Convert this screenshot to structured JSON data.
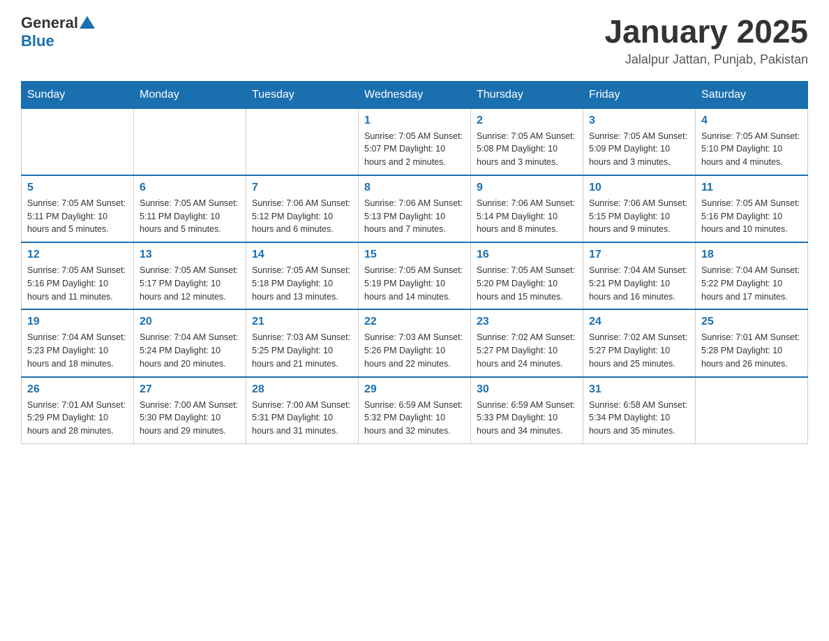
{
  "header": {
    "title": "January 2025",
    "location": "Jalalpur Jattan, Punjab, Pakistan",
    "logo_general": "General",
    "logo_blue": "Blue"
  },
  "weekdays": [
    "Sunday",
    "Monday",
    "Tuesday",
    "Wednesday",
    "Thursday",
    "Friday",
    "Saturday"
  ],
  "weeks": [
    [
      {
        "day": "",
        "info": ""
      },
      {
        "day": "",
        "info": ""
      },
      {
        "day": "",
        "info": ""
      },
      {
        "day": "1",
        "info": "Sunrise: 7:05 AM\nSunset: 5:07 PM\nDaylight: 10 hours\nand 2 minutes."
      },
      {
        "day": "2",
        "info": "Sunrise: 7:05 AM\nSunset: 5:08 PM\nDaylight: 10 hours\nand 3 minutes."
      },
      {
        "day": "3",
        "info": "Sunrise: 7:05 AM\nSunset: 5:09 PM\nDaylight: 10 hours\nand 3 minutes."
      },
      {
        "day": "4",
        "info": "Sunrise: 7:05 AM\nSunset: 5:10 PM\nDaylight: 10 hours\nand 4 minutes."
      }
    ],
    [
      {
        "day": "5",
        "info": "Sunrise: 7:05 AM\nSunset: 5:11 PM\nDaylight: 10 hours\nand 5 minutes."
      },
      {
        "day": "6",
        "info": "Sunrise: 7:05 AM\nSunset: 5:11 PM\nDaylight: 10 hours\nand 5 minutes."
      },
      {
        "day": "7",
        "info": "Sunrise: 7:06 AM\nSunset: 5:12 PM\nDaylight: 10 hours\nand 6 minutes."
      },
      {
        "day": "8",
        "info": "Sunrise: 7:06 AM\nSunset: 5:13 PM\nDaylight: 10 hours\nand 7 minutes."
      },
      {
        "day": "9",
        "info": "Sunrise: 7:06 AM\nSunset: 5:14 PM\nDaylight: 10 hours\nand 8 minutes."
      },
      {
        "day": "10",
        "info": "Sunrise: 7:06 AM\nSunset: 5:15 PM\nDaylight: 10 hours\nand 9 minutes."
      },
      {
        "day": "11",
        "info": "Sunrise: 7:05 AM\nSunset: 5:16 PM\nDaylight: 10 hours\nand 10 minutes."
      }
    ],
    [
      {
        "day": "12",
        "info": "Sunrise: 7:05 AM\nSunset: 5:16 PM\nDaylight: 10 hours\nand 11 minutes."
      },
      {
        "day": "13",
        "info": "Sunrise: 7:05 AM\nSunset: 5:17 PM\nDaylight: 10 hours\nand 12 minutes."
      },
      {
        "day": "14",
        "info": "Sunrise: 7:05 AM\nSunset: 5:18 PM\nDaylight: 10 hours\nand 13 minutes."
      },
      {
        "day": "15",
        "info": "Sunrise: 7:05 AM\nSunset: 5:19 PM\nDaylight: 10 hours\nand 14 minutes."
      },
      {
        "day": "16",
        "info": "Sunrise: 7:05 AM\nSunset: 5:20 PM\nDaylight: 10 hours\nand 15 minutes."
      },
      {
        "day": "17",
        "info": "Sunrise: 7:04 AM\nSunset: 5:21 PM\nDaylight: 10 hours\nand 16 minutes."
      },
      {
        "day": "18",
        "info": "Sunrise: 7:04 AM\nSunset: 5:22 PM\nDaylight: 10 hours\nand 17 minutes."
      }
    ],
    [
      {
        "day": "19",
        "info": "Sunrise: 7:04 AM\nSunset: 5:23 PM\nDaylight: 10 hours\nand 18 minutes."
      },
      {
        "day": "20",
        "info": "Sunrise: 7:04 AM\nSunset: 5:24 PM\nDaylight: 10 hours\nand 20 minutes."
      },
      {
        "day": "21",
        "info": "Sunrise: 7:03 AM\nSunset: 5:25 PM\nDaylight: 10 hours\nand 21 minutes."
      },
      {
        "day": "22",
        "info": "Sunrise: 7:03 AM\nSunset: 5:26 PM\nDaylight: 10 hours\nand 22 minutes."
      },
      {
        "day": "23",
        "info": "Sunrise: 7:02 AM\nSunset: 5:27 PM\nDaylight: 10 hours\nand 24 minutes."
      },
      {
        "day": "24",
        "info": "Sunrise: 7:02 AM\nSunset: 5:27 PM\nDaylight: 10 hours\nand 25 minutes."
      },
      {
        "day": "25",
        "info": "Sunrise: 7:01 AM\nSunset: 5:28 PM\nDaylight: 10 hours\nand 26 minutes."
      }
    ],
    [
      {
        "day": "26",
        "info": "Sunrise: 7:01 AM\nSunset: 5:29 PM\nDaylight: 10 hours\nand 28 minutes."
      },
      {
        "day": "27",
        "info": "Sunrise: 7:00 AM\nSunset: 5:30 PM\nDaylight: 10 hours\nand 29 minutes."
      },
      {
        "day": "28",
        "info": "Sunrise: 7:00 AM\nSunset: 5:31 PM\nDaylight: 10 hours\nand 31 minutes."
      },
      {
        "day": "29",
        "info": "Sunrise: 6:59 AM\nSunset: 5:32 PM\nDaylight: 10 hours\nand 32 minutes."
      },
      {
        "day": "30",
        "info": "Sunrise: 6:59 AM\nSunset: 5:33 PM\nDaylight: 10 hours\nand 34 minutes."
      },
      {
        "day": "31",
        "info": "Sunrise: 6:58 AM\nSunset: 5:34 PM\nDaylight: 10 hours\nand 35 minutes."
      },
      {
        "day": "",
        "info": ""
      }
    ]
  ]
}
